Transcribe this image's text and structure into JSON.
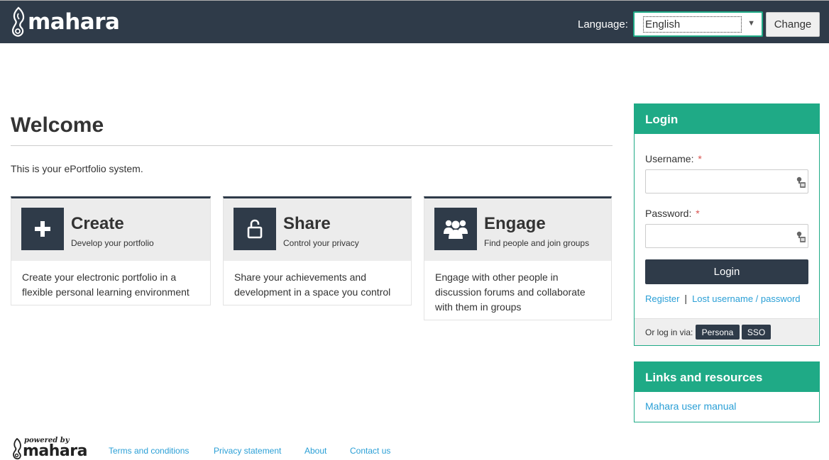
{
  "header": {
    "logo_text": "mahara",
    "language_label": "Language:",
    "language_selected": "English",
    "change_button": "Change",
    "bg_color": "#2f3b49"
  },
  "main": {
    "title": "Welcome",
    "intro": "This is your ePortfolio system.",
    "cards": [
      {
        "icon": "plus-icon",
        "title": "Create",
        "subtitle": "Develop your portfolio",
        "body": "Create your electronic portfolio in a flexible personal learning environment"
      },
      {
        "icon": "unlock-icon",
        "title": "Share",
        "subtitle": "Control your privacy",
        "body": "Share your achievements and development in a space you control"
      },
      {
        "icon": "users-icon",
        "title": "Engage",
        "subtitle": "Find people and join groups",
        "body": "Engage with other people in discussion forums and collaborate with them in groups"
      }
    ]
  },
  "login": {
    "title": "Login",
    "username_label": "Username:",
    "password_label": "Password:",
    "required_mark": "*",
    "username_value": "",
    "password_value": "",
    "login_button": "Login",
    "register_link": "Register",
    "separator": "|",
    "lost_link": "Lost username / password",
    "via_label": "Or log in via:",
    "via_buttons": [
      "Persona",
      "SSO"
    ],
    "accent_color": "#1faa86"
  },
  "resources": {
    "title": "Links and resources",
    "links": [
      "Mahara user manual"
    ]
  },
  "footer": {
    "powered_by": "powered by",
    "powered_logo": "mahara",
    "links": [
      "Terms and conditions",
      "Privacy statement",
      "About",
      "Contact us"
    ]
  }
}
